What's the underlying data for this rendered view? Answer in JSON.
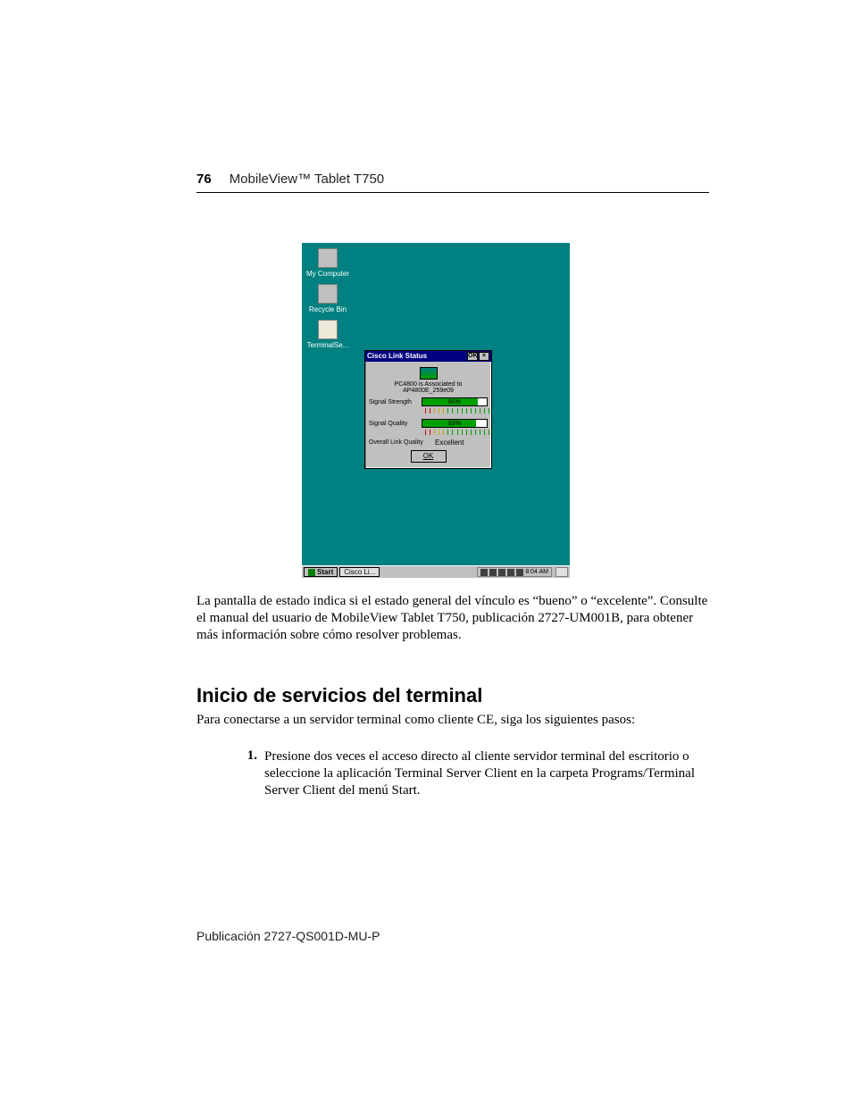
{
  "header": {
    "page_number": "76",
    "title": "MobileView™ Tablet T750"
  },
  "screenshot": {
    "desktop": {
      "my_computer": "My Computer",
      "recycle_bin": "Recycle Bin",
      "terminal_se": "TerminalSe..."
    },
    "window": {
      "title": "Cisco Link Status",
      "ok_caption": "OK",
      "close_caption": "×",
      "assoc_text": "PC4800 is Associated to AP4800E_259e09",
      "signal_strength_label": "Signal Strength",
      "signal_strength_value": "86%",
      "signal_strength_fill": 86,
      "signal_quality_label": "Signal Quality",
      "signal_quality_value": "83%",
      "signal_quality_fill": 83,
      "overall_label": "Overall Link Quality",
      "overall_value": "Excellent",
      "ok_button": "OK"
    },
    "taskbar": {
      "start": "Start",
      "task1": "Cisco Li...",
      "clock": "8:04 AM"
    }
  },
  "body": {
    "para1": "La pantalla de estado indica si el estado general del vínculo es “bueno” o “excelente”. Consulte el manual del usuario de MobileView Tablet T750, publicación 2727-UM001B, para obtener más información sobre cómo resolver problemas.",
    "heading": "Inicio de servicios del terminal",
    "para2": "Para conectarse a un servidor terminal como cliente CE, siga los siguientes pasos:",
    "step1_num": "1.",
    "step1_text": "Presione dos veces el acceso directo al cliente servidor terminal del escritorio o seleccione la aplicación Terminal Server Client en la carpeta Programs/Terminal Server Client del menú Start."
  },
  "footer": "Publicación 2727-QS001D-MU-P"
}
